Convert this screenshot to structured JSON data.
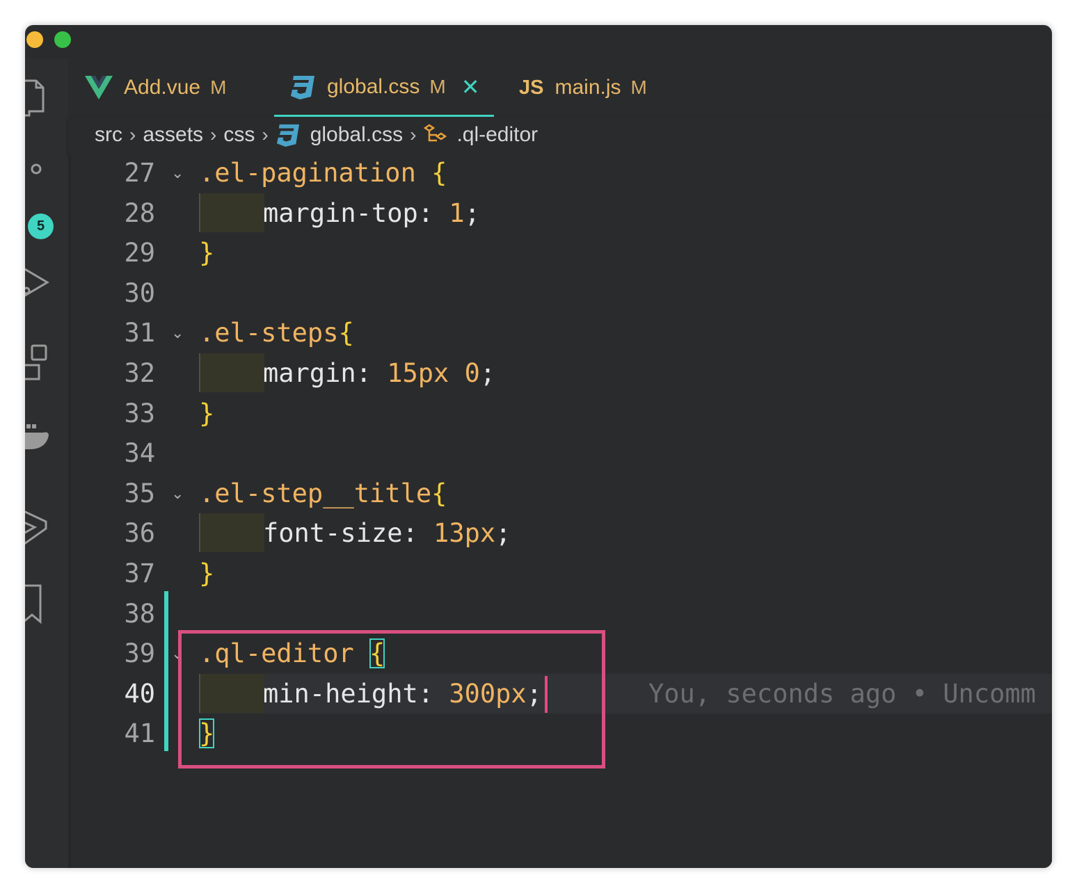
{
  "tabs": [
    {
      "label": "Add.vue",
      "status": "M",
      "icon": "vue-icon"
    },
    {
      "label": "global.css",
      "status": "M",
      "icon": "css-icon",
      "active": true,
      "close": "✕"
    },
    {
      "label": "main.js",
      "status": "M",
      "icon": "js-icon",
      "icon_text": "JS"
    }
  ],
  "breadcrumbs": [
    "src",
    "assets",
    "css",
    "global.css",
    ".ql-editor"
  ],
  "activity_badge": "5",
  "code_lines": [
    {
      "n": "27",
      "fold": true,
      "tokens": [
        {
          "t": ".el-pagination ",
          "c": "sel"
        },
        {
          "t": "{",
          "c": "brace"
        }
      ]
    },
    {
      "n": "28",
      "indent": true,
      "tokens": [
        {
          "t": "margin-top",
          "c": "prop"
        },
        {
          "t": ": ",
          "c": "punc"
        },
        {
          "t": "1",
          "c": "num"
        },
        {
          "t": ";",
          "c": "punc"
        }
      ]
    },
    {
      "n": "29",
      "tokens": [
        {
          "t": "}",
          "c": "brace"
        }
      ]
    },
    {
      "n": "30",
      "tokens": []
    },
    {
      "n": "31",
      "fold": true,
      "tokens": [
        {
          "t": ".el-steps",
          "c": "sel"
        },
        {
          "t": "{",
          "c": "brace"
        }
      ]
    },
    {
      "n": "32",
      "indent": true,
      "tokens": [
        {
          "t": "margin",
          "c": "prop"
        },
        {
          "t": ": ",
          "c": "punc"
        },
        {
          "t": "15px 0",
          "c": "num"
        },
        {
          "t": ";",
          "c": "punc"
        }
      ]
    },
    {
      "n": "33",
      "tokens": [
        {
          "t": "}",
          "c": "brace"
        }
      ]
    },
    {
      "n": "34",
      "tokens": []
    },
    {
      "n": "35",
      "fold": true,
      "tokens": [
        {
          "t": ".el-step__title",
          "c": "sel"
        },
        {
          "t": "{",
          "c": "brace"
        }
      ]
    },
    {
      "n": "36",
      "indent": true,
      "tokens": [
        {
          "t": "font-size",
          "c": "prop"
        },
        {
          "t": ": ",
          "c": "punc"
        },
        {
          "t": "13px",
          "c": "num"
        },
        {
          "t": ";",
          "c": "punc"
        }
      ]
    },
    {
      "n": "37",
      "tokens": [
        {
          "t": "}",
          "c": "brace"
        }
      ]
    },
    {
      "n": "38",
      "tokens": []
    },
    {
      "n": "39",
      "fold": true,
      "tokens": [
        {
          "t": ".ql-editor ",
          "c": "sel"
        },
        {
          "t": "{",
          "c": "brace",
          "hl": true
        }
      ]
    },
    {
      "n": "40",
      "indent": true,
      "current": true,
      "tokens": [
        {
          "t": "min-height",
          "c": "prop"
        },
        {
          "t": ": ",
          "c": "punc"
        },
        {
          "t": "300px",
          "c": "num"
        },
        {
          "t": ";",
          "c": "punc"
        }
      ]
    },
    {
      "n": "41",
      "tokens": [
        {
          "t": "}",
          "c": "brace",
          "hl": true
        }
      ]
    }
  ],
  "blame_text": "You, seconds ago • Uncomm",
  "colors": {
    "accent": "#40d4c2",
    "highlight_box": "#d84f80",
    "selector": "#f0b462",
    "brace": "#f3d13b"
  }
}
